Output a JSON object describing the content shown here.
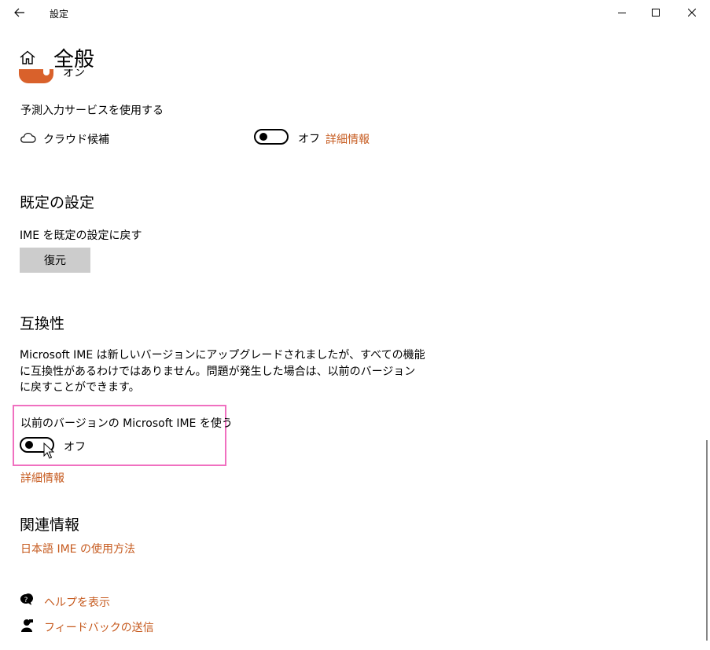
{
  "titlebar": {
    "title": "設定"
  },
  "header": {
    "title": "全般"
  },
  "ime_top": {
    "partial_state": "オン"
  },
  "prediction": {
    "title": "予測入力サービスを使用する",
    "cloud_label": "クラウド候補",
    "toggle_state": "オフ",
    "details_link": "詳細情報"
  },
  "defaults": {
    "heading": "既定の設定",
    "label": "IME を既定の設定に戻す",
    "button_label": "復元"
  },
  "compat": {
    "heading": "互換性",
    "description_lines": [
      "Microsoft IME は新しいバージョンにアップグレードされましたが、すべての機能",
      "に互換性があるわけではありません。問題が発生した場合は、以前のバージョン",
      "に戻すことができます。"
    ],
    "option_label": "以前のバージョンの Microsoft IME を使う",
    "toggle_state": "オフ",
    "details_link": "詳細情報"
  },
  "related": {
    "heading": "関連情報",
    "link": "日本語 IME の使用方法"
  },
  "footer": {
    "help": "ヘルプを表示",
    "feedback": "フィードバックの送信"
  },
  "colors": {
    "accent": "#c65a1e",
    "toggle_on": "#d9612b",
    "highlight": "#f070c0"
  }
}
